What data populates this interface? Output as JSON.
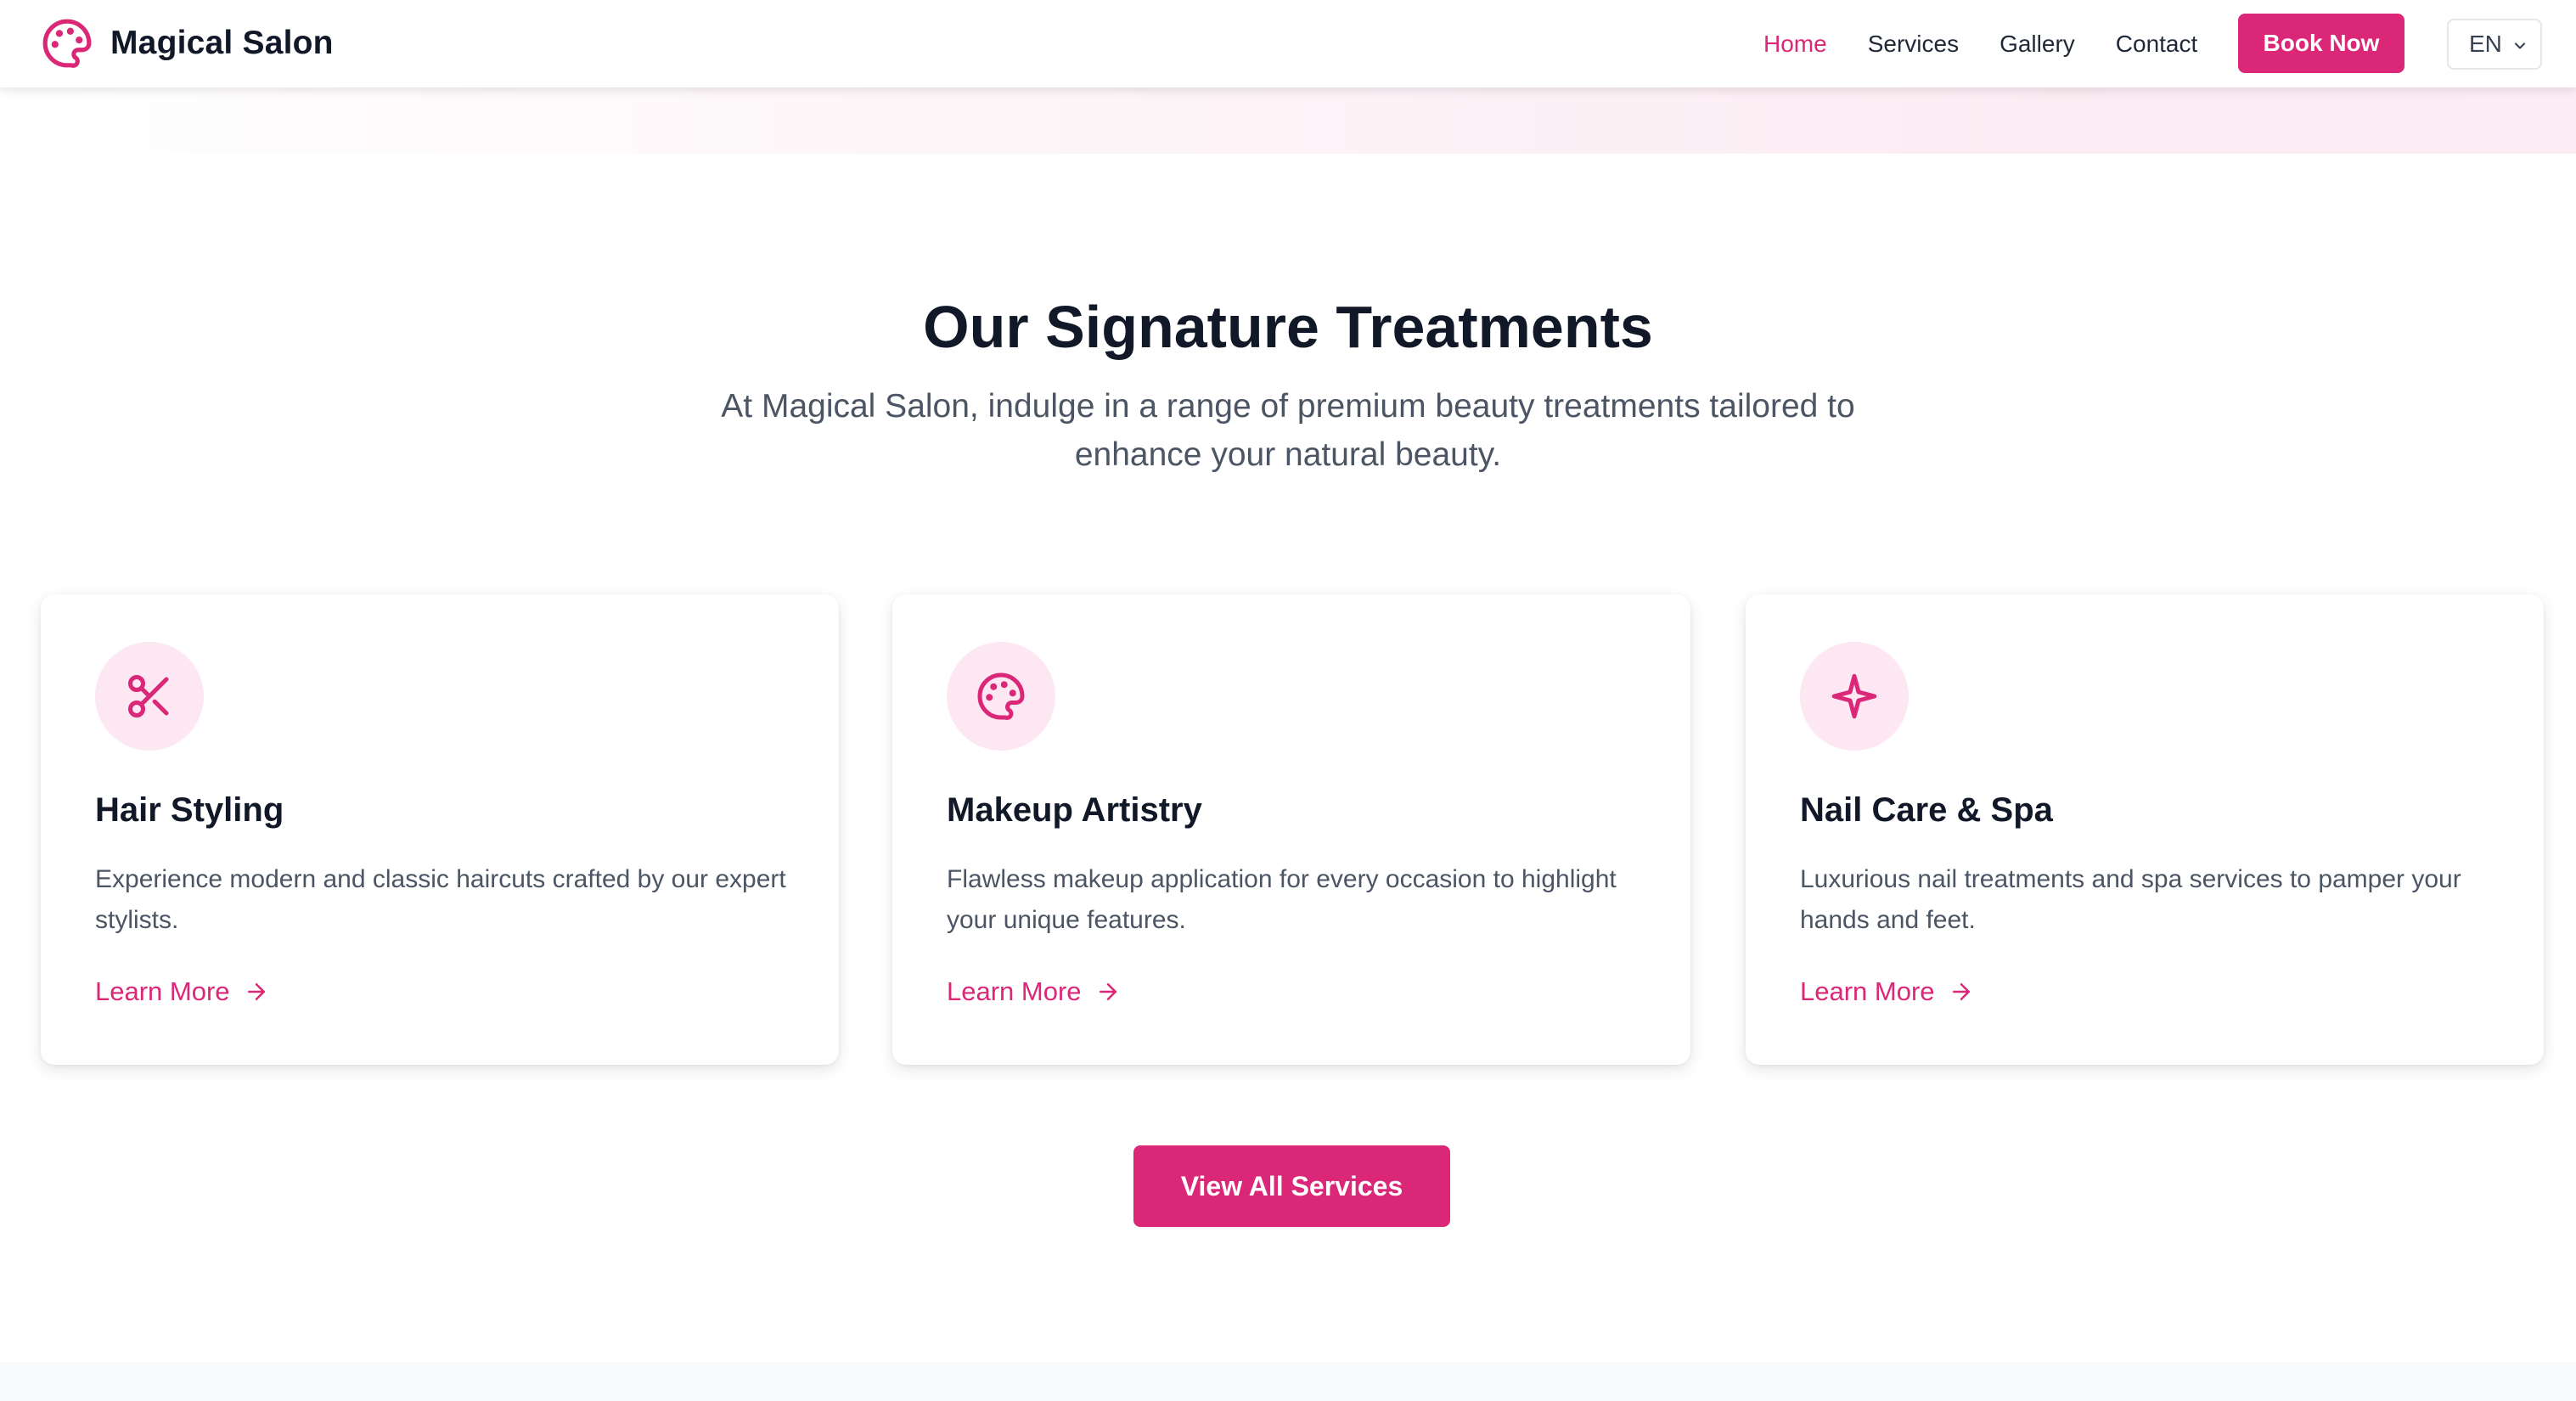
{
  "brand": {
    "name": "Magical Salon",
    "logo_icon": "palette-icon",
    "accent_color": "#db2777",
    "accent_tint": "#fce7f3"
  },
  "nav": {
    "items": [
      {
        "label": "Home",
        "active": true
      },
      {
        "label": "Services",
        "active": false
      },
      {
        "label": "Gallery",
        "active": false
      },
      {
        "label": "Contact",
        "active": false
      }
    ],
    "cta_label": "Book Now",
    "language": "EN"
  },
  "section": {
    "title": "Our Signature Treatments",
    "subtitle": "At Magical Salon, indulge in a range of premium beauty treatments tailored to enhance your natural beauty."
  },
  "services": [
    {
      "icon": "scissors-icon",
      "title": "Hair Styling",
      "description": "Experience modern and classic haircuts crafted by our expert stylists.",
      "link_label": "Learn More"
    },
    {
      "icon": "palette-icon",
      "title": "Makeup Artistry",
      "description": "Flawless makeup application for every occasion to highlight your unique features.",
      "link_label": "Learn More"
    },
    {
      "icon": "sparkle-icon",
      "title": "Nail Care & Spa",
      "description": "Luxurious nail treatments and spa services to pamper your hands and feet.",
      "link_label": "Learn More"
    }
  ],
  "view_all_label": "View All Services"
}
